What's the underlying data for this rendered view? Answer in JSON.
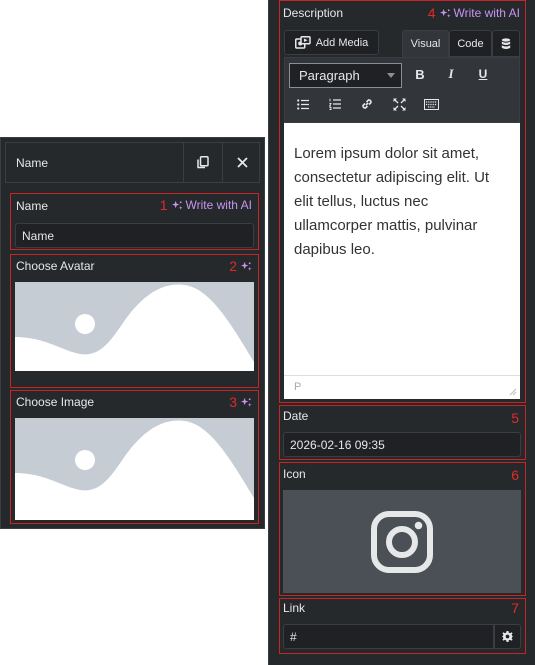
{
  "left_panel": {
    "title": "Name",
    "fields": {
      "name": {
        "label": "Name",
        "number": "1",
        "ai_label": "Write with AI",
        "value": "Name"
      },
      "avatar": {
        "label": "Choose Avatar",
        "number": "2"
      },
      "image": {
        "label": "Choose Image",
        "number": "3"
      }
    }
  },
  "right_panel": {
    "description": {
      "label": "Description",
      "number": "4",
      "ai_label": "Write with AI",
      "add_media_label": "Add Media",
      "tab_visual": "Visual",
      "tab_code": "Code",
      "format_select": "Paragraph",
      "bold": "B",
      "italic": "I",
      "underline": "U",
      "content": "Lorem ipsum dolor sit amet, consectetur adipiscing elit. Ut elit tellus, luctus nec ullamcorper mattis, pulvinar dapibus leo.",
      "status_path": "P"
    },
    "date": {
      "label": "Date",
      "number": "5",
      "value": "2026-02-16 09:35"
    },
    "icon": {
      "label": "Icon",
      "number": "6",
      "preview_icon": "instagram-icon"
    },
    "link": {
      "label": "Link",
      "number": "7",
      "value": "#"
    }
  },
  "colors": {
    "panel_bg": "#26292c",
    "input_bg": "#1f2124",
    "accent_ai": "#c894f0",
    "highlight": "#c92323",
    "placeholder": "#c5ccd3"
  }
}
